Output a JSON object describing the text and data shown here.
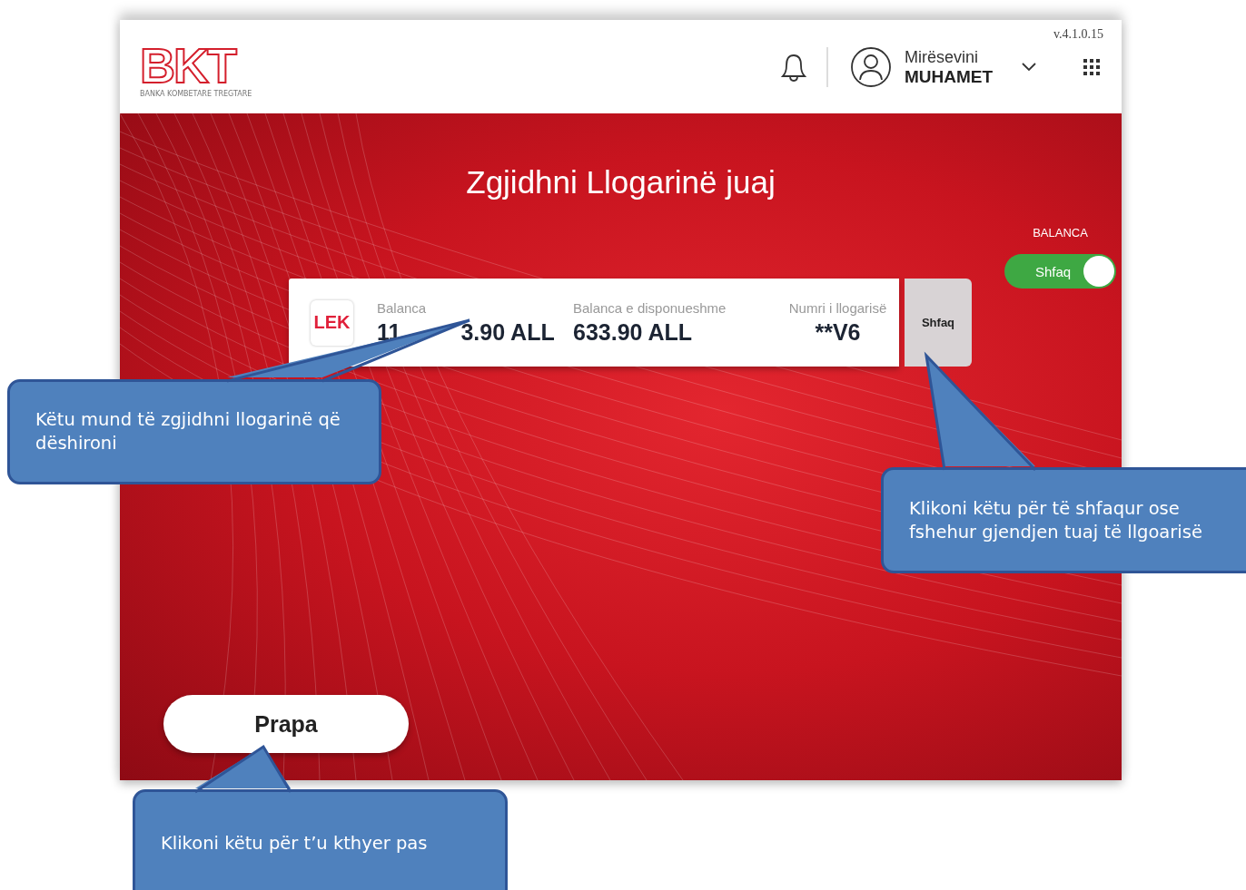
{
  "header": {
    "logo": {
      "mark": "BKT",
      "subtitle": "BANKA KOMBETARE TREGTARE"
    },
    "version": "v.4.1.0.15",
    "greeting": "Mirësevini",
    "user_name": "MUHAMET"
  },
  "title": "Zgjidhni Llogarinë juaj",
  "balance_toggle": {
    "label": "BALANCA",
    "text": "Shfaq",
    "on": true
  },
  "account": {
    "currency": "LEK",
    "columns": [
      {
        "label": "Balanca",
        "value_parts": [
          "11",
          "3.90 ALL"
        ]
      },
      {
        "label": "Balanca e disponueshme",
        "value_parts": [
          "633.90 ALL"
        ]
      },
      {
        "label": "Numri i llogarisë",
        "value_parts": [
          "**V6"
        ]
      }
    ],
    "show_button": "Shfaq"
  },
  "back_button": "Prapa",
  "callouts": [
    {
      "kind": "account",
      "text": "Këtu mund të zgjidhni llogarinë që dëshironi"
    },
    {
      "kind": "show",
      "text": "Klikoni këtu për të shfaqur ose fshehur gjendjen tuaj të llgoarisë"
    },
    {
      "kind": "back",
      "text": "Klikoni këtu për t’u kthyer pas"
    }
  ]
}
